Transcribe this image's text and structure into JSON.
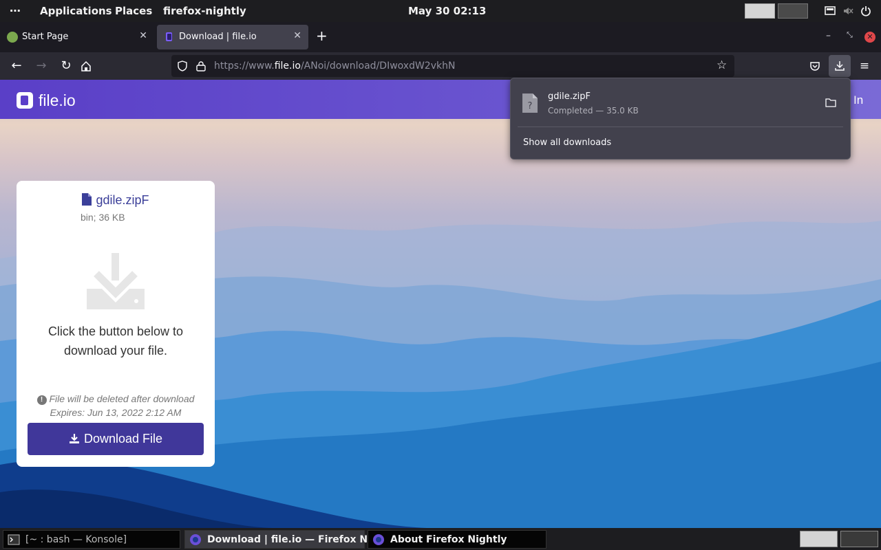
{
  "topbar": {
    "activities_glyph": "⋯",
    "applications": "Applications",
    "places": "Places",
    "app_name": "firefox-nightly",
    "clock": "May 30  02:13"
  },
  "tabs": [
    {
      "title": "Start Page",
      "active": false
    },
    {
      "title": "Download | file.io",
      "active": true
    }
  ],
  "navbar": {
    "url_prefix": "https://www.",
    "url_host": "file.io",
    "url_path": "/ANoi/download/DIwoxdW2vkhN"
  },
  "site": {
    "logo_text": "file.io",
    "signin_label": "In"
  },
  "card": {
    "file_name": "gdile.zipF",
    "file_meta": "bin; 36 KB",
    "prompt": "Click the button below to download your file.",
    "note_line1": "File will be deleted after download",
    "note_line2": "Expires: Jun 13, 2022 2:12 AM",
    "download_button": "Download File"
  },
  "downloads_panel": {
    "file_name": "gdile.zipF",
    "status": "Completed — 35.0 KB",
    "show_all": "Show all downloads"
  },
  "taskbar": {
    "items": [
      {
        "label": "[~ : bash — Konsole]",
        "active": false
      },
      {
        "label": "Download | file.io — Firefox Nig...",
        "active": true
      },
      {
        "label": "About Firefox Nightly",
        "active": false
      }
    ]
  },
  "colors": {
    "header_purple": "#5a3fc7",
    "button_purple": "#40379a",
    "panel_bg": "#42414d"
  }
}
